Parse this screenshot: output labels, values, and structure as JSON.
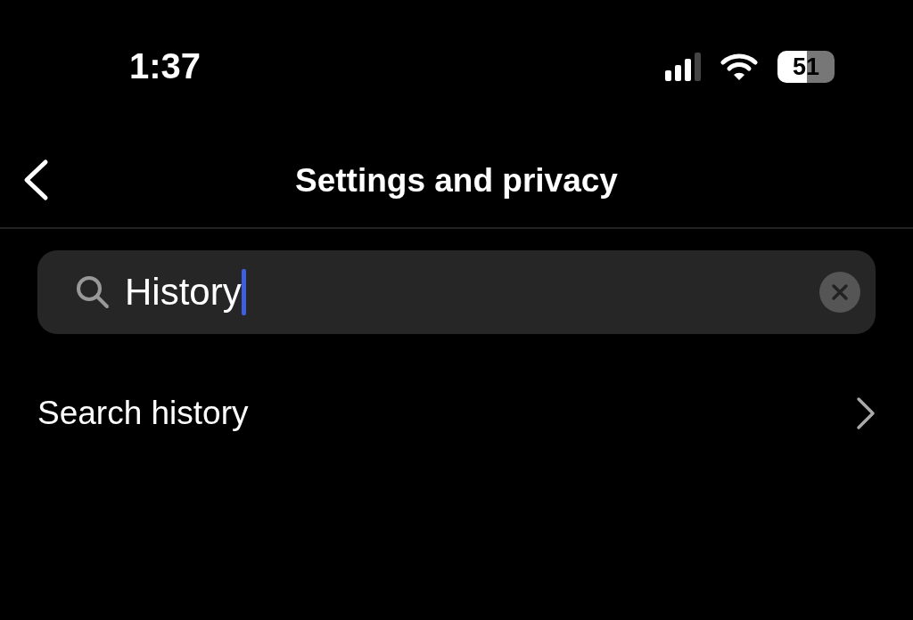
{
  "status_bar": {
    "time": "1:37",
    "battery": "51"
  },
  "nav": {
    "title": "Settings and privacy"
  },
  "search": {
    "value": "History",
    "focused": true
  },
  "results": [
    {
      "label": "Search history"
    }
  ]
}
